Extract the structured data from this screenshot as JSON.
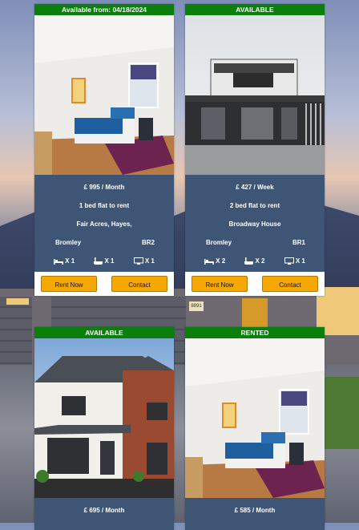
{
  "cards": [
    {
      "status": "Available from: 04/18/2024",
      "price": "£ 995 / Month",
      "title": "1 bed flat to rent",
      "address": "Fair Acres, Hayes,",
      "town": "Bromley",
      "postcode": "BR2",
      "beds": "X 1",
      "baths": "X 1",
      "receptions": "X 1",
      "rent_button": "Rent Now",
      "contact_button": "Contact"
    },
    {
      "status": "AVAILABLE",
      "price": "£ 427 / Week",
      "title": "2 bed flat to rent",
      "address": "Broadway House",
      "town": "Bromley",
      "postcode": "BR1",
      "beds": "X 2",
      "baths": "X 2",
      "receptions": "X 1",
      "rent_button": "Rent Now",
      "contact_button": "Contact"
    },
    {
      "status": "AVAILABLE",
      "price": "£ 695 / Month"
    },
    {
      "status": "RENTED",
      "price": "£ 585 / Month"
    }
  ],
  "house_number": "8891",
  "colors": {
    "badge": "#0b7f0b",
    "info_panel": "#203960",
    "button": "#f5a800"
  },
  "icons": [
    "bed-icon",
    "bath-icon",
    "reception-tv-icon"
  ]
}
